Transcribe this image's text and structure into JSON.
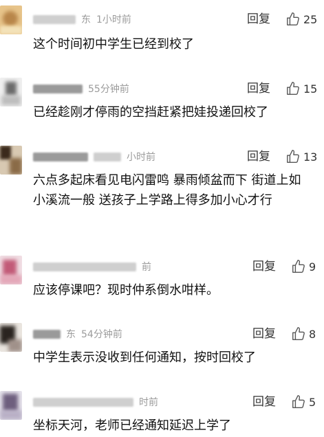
{
  "comments": [
    {
      "name": "东",
      "time": "1小时前",
      "reply_label": "回复",
      "like_count": "25",
      "text": "这个时间初中学生已经到校了"
    },
    {
      "name": "",
      "time": "55分钟前",
      "reply_label": "回复",
      "like_count": "15",
      "text": "已经趁刚才停雨的空挡赶紧把娃投递回校了"
    },
    {
      "name": "",
      "time": "小时前",
      "reply_label": "回复",
      "like_count": "13",
      "text": "六点多起床看见电闪雷鸣 暴雨倾盆而下 街道上如小溪流一般 送孩子上学路上得多加小心才行"
    },
    {
      "name": "",
      "time": "前",
      "reply_label": "回复",
      "like_count": "9",
      "text": "应该停课吧？现时仲系倒水咁样。"
    },
    {
      "name": "东",
      "time": "54分钟前",
      "reply_label": "回复",
      "like_count": "8",
      "text": "中学生表示没收到任何通知，按时回校了"
    },
    {
      "name": "",
      "time": "时前",
      "reply_label": "回复",
      "like_count": "5",
      "text": "坐标天河，老师已经通知延迟上学了"
    }
  ],
  "icons": {
    "like": "thumbs-up-icon"
  },
  "colors": {
    "text": "#111111",
    "meta": "#9b9b9b",
    "action": "#333333"
  }
}
